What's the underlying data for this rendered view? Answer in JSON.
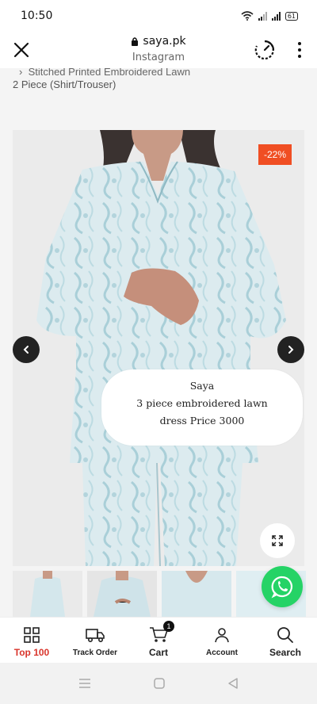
{
  "status_bar": {
    "time": "10:50",
    "battery": "61"
  },
  "browser": {
    "host": "saya.pk",
    "subtitle": "Instagram"
  },
  "breadcrumb": {
    "line1": "Stitched Printed Embroidered Lawn",
    "line2": "2 Piece (Shirt/Trouser)"
  },
  "product": {
    "discount_badge": "-22%",
    "overlay_lines": [
      "Saya",
      "3 piece embroidered lawn",
      "dress Price 3000"
    ],
    "colors": {
      "badge": "#f04e23",
      "fabric": "#cfe4ea",
      "whatsapp": "#25d366"
    }
  },
  "tabs": [
    {
      "label": "Top 100",
      "icon": "grid-icon",
      "active": true
    },
    {
      "label": "Track Order",
      "icon": "truck-icon",
      "active": false
    },
    {
      "label": "Cart",
      "icon": "cart-icon",
      "active": false,
      "badge": "1"
    },
    {
      "label": "Account",
      "icon": "user-icon",
      "active": false
    },
    {
      "label": "Search",
      "icon": "search-icon",
      "active": false
    }
  ]
}
